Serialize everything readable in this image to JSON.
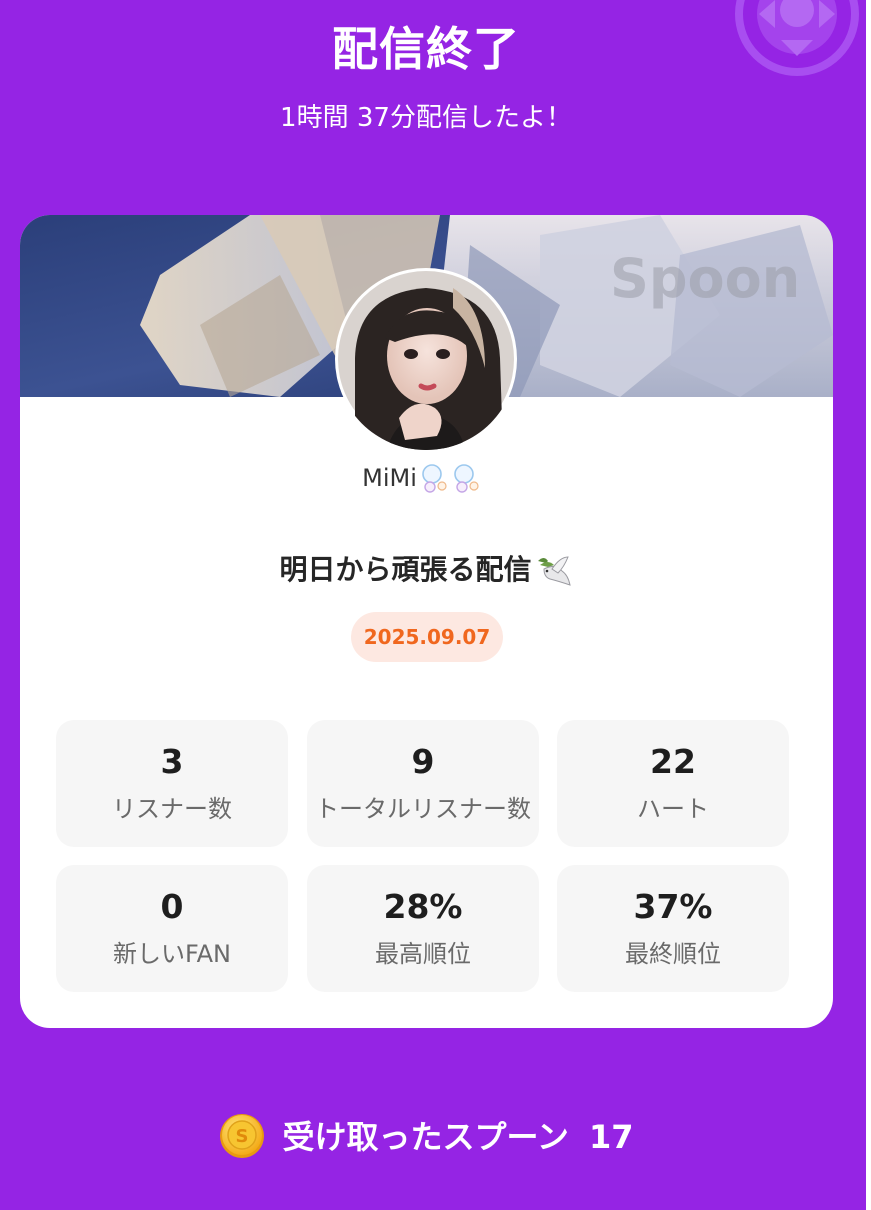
{
  "header": {
    "title": "配信終了",
    "duration_text": "1時間 37分配信したよ！"
  },
  "card": {
    "watermark": "Spoon",
    "username": "MiMi",
    "live_title": "明日から頑張る配信",
    "date": "2025.09.07"
  },
  "stats": [
    {
      "value": "3",
      "label": "リスナー数"
    },
    {
      "value": "9",
      "label": "トータルリスナー数"
    },
    {
      "value": "22",
      "label": "ハート"
    },
    {
      "value": "0",
      "label": "新しいFAN"
    },
    {
      "value": "28%",
      "label": "最高順位"
    },
    {
      "value": "37%",
      "label": "最終順位"
    }
  ],
  "spoons": {
    "label": "受け取ったスプーン",
    "count": "17",
    "coin_letter": "S"
  },
  "icons": [
    "spoon-logo-icon",
    "bubble-emoji-icon",
    "dove-emoji-icon",
    "coin-icon"
  ],
  "colors": {
    "background": "#9524e4",
    "card": "#ffffff",
    "date_badge_bg": "#fde8e1",
    "date_text": "#f0671e",
    "stat_tile": "#f6f6f6"
  }
}
